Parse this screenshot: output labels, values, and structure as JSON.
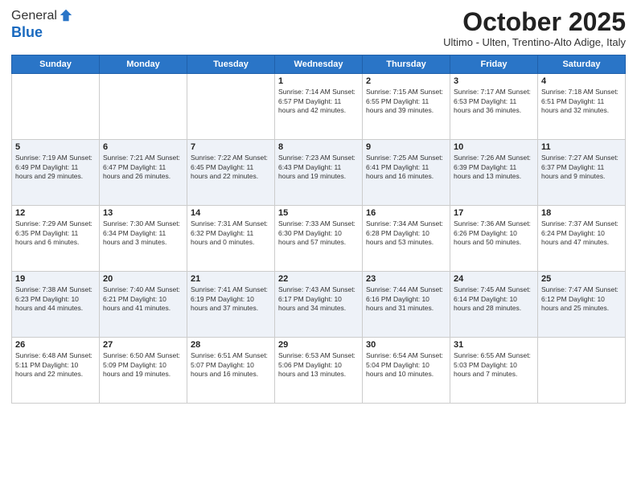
{
  "logo": {
    "general": "General",
    "blue": "Blue"
  },
  "header": {
    "month": "October 2025",
    "location": "Ultimo - Ulten, Trentino-Alto Adige, Italy"
  },
  "days_of_week": [
    "Sunday",
    "Monday",
    "Tuesday",
    "Wednesday",
    "Thursday",
    "Friday",
    "Saturday"
  ],
  "weeks": [
    [
      {
        "day": "",
        "info": ""
      },
      {
        "day": "",
        "info": ""
      },
      {
        "day": "",
        "info": ""
      },
      {
        "day": "1",
        "info": "Sunrise: 7:14 AM\nSunset: 6:57 PM\nDaylight: 11 hours and 42 minutes."
      },
      {
        "day": "2",
        "info": "Sunrise: 7:15 AM\nSunset: 6:55 PM\nDaylight: 11 hours and 39 minutes."
      },
      {
        "day": "3",
        "info": "Sunrise: 7:17 AM\nSunset: 6:53 PM\nDaylight: 11 hours and 36 minutes."
      },
      {
        "day": "4",
        "info": "Sunrise: 7:18 AM\nSunset: 6:51 PM\nDaylight: 11 hours and 32 minutes."
      }
    ],
    [
      {
        "day": "5",
        "info": "Sunrise: 7:19 AM\nSunset: 6:49 PM\nDaylight: 11 hours and 29 minutes."
      },
      {
        "day": "6",
        "info": "Sunrise: 7:21 AM\nSunset: 6:47 PM\nDaylight: 11 hours and 26 minutes."
      },
      {
        "day": "7",
        "info": "Sunrise: 7:22 AM\nSunset: 6:45 PM\nDaylight: 11 hours and 22 minutes."
      },
      {
        "day": "8",
        "info": "Sunrise: 7:23 AM\nSunset: 6:43 PM\nDaylight: 11 hours and 19 minutes."
      },
      {
        "day": "9",
        "info": "Sunrise: 7:25 AM\nSunset: 6:41 PM\nDaylight: 11 hours and 16 minutes."
      },
      {
        "day": "10",
        "info": "Sunrise: 7:26 AM\nSunset: 6:39 PM\nDaylight: 11 hours and 13 minutes."
      },
      {
        "day": "11",
        "info": "Sunrise: 7:27 AM\nSunset: 6:37 PM\nDaylight: 11 hours and 9 minutes."
      }
    ],
    [
      {
        "day": "12",
        "info": "Sunrise: 7:29 AM\nSunset: 6:35 PM\nDaylight: 11 hours and 6 minutes."
      },
      {
        "day": "13",
        "info": "Sunrise: 7:30 AM\nSunset: 6:34 PM\nDaylight: 11 hours and 3 minutes."
      },
      {
        "day": "14",
        "info": "Sunrise: 7:31 AM\nSunset: 6:32 PM\nDaylight: 11 hours and 0 minutes."
      },
      {
        "day": "15",
        "info": "Sunrise: 7:33 AM\nSunset: 6:30 PM\nDaylight: 10 hours and 57 minutes."
      },
      {
        "day": "16",
        "info": "Sunrise: 7:34 AM\nSunset: 6:28 PM\nDaylight: 10 hours and 53 minutes."
      },
      {
        "day": "17",
        "info": "Sunrise: 7:36 AM\nSunset: 6:26 PM\nDaylight: 10 hours and 50 minutes."
      },
      {
        "day": "18",
        "info": "Sunrise: 7:37 AM\nSunset: 6:24 PM\nDaylight: 10 hours and 47 minutes."
      }
    ],
    [
      {
        "day": "19",
        "info": "Sunrise: 7:38 AM\nSunset: 6:23 PM\nDaylight: 10 hours and 44 minutes."
      },
      {
        "day": "20",
        "info": "Sunrise: 7:40 AM\nSunset: 6:21 PM\nDaylight: 10 hours and 41 minutes."
      },
      {
        "day": "21",
        "info": "Sunrise: 7:41 AM\nSunset: 6:19 PM\nDaylight: 10 hours and 37 minutes."
      },
      {
        "day": "22",
        "info": "Sunrise: 7:43 AM\nSunset: 6:17 PM\nDaylight: 10 hours and 34 minutes."
      },
      {
        "day": "23",
        "info": "Sunrise: 7:44 AM\nSunset: 6:16 PM\nDaylight: 10 hours and 31 minutes."
      },
      {
        "day": "24",
        "info": "Sunrise: 7:45 AM\nSunset: 6:14 PM\nDaylight: 10 hours and 28 minutes."
      },
      {
        "day": "25",
        "info": "Sunrise: 7:47 AM\nSunset: 6:12 PM\nDaylight: 10 hours and 25 minutes."
      }
    ],
    [
      {
        "day": "26",
        "info": "Sunrise: 6:48 AM\nSunset: 5:11 PM\nDaylight: 10 hours and 22 minutes."
      },
      {
        "day": "27",
        "info": "Sunrise: 6:50 AM\nSunset: 5:09 PM\nDaylight: 10 hours and 19 minutes."
      },
      {
        "day": "28",
        "info": "Sunrise: 6:51 AM\nSunset: 5:07 PM\nDaylight: 10 hours and 16 minutes."
      },
      {
        "day": "29",
        "info": "Sunrise: 6:53 AM\nSunset: 5:06 PM\nDaylight: 10 hours and 13 minutes."
      },
      {
        "day": "30",
        "info": "Sunrise: 6:54 AM\nSunset: 5:04 PM\nDaylight: 10 hours and 10 minutes."
      },
      {
        "day": "31",
        "info": "Sunrise: 6:55 AM\nSunset: 5:03 PM\nDaylight: 10 hours and 7 minutes."
      },
      {
        "day": "",
        "info": ""
      }
    ]
  ]
}
